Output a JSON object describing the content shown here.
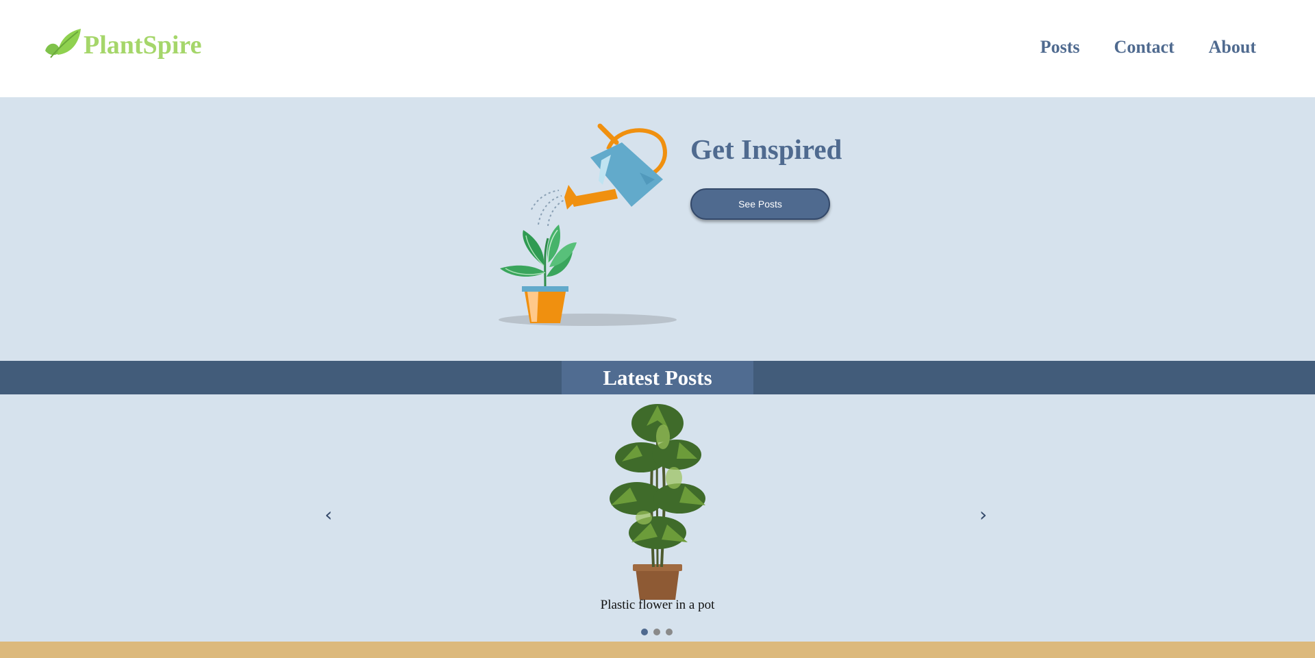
{
  "header": {
    "brand": "PlantSpire",
    "logo_icon": "leaf-icon",
    "brand_color": "#a5d66a",
    "nav": [
      {
        "label": "Posts"
      },
      {
        "label": "Contact"
      },
      {
        "label": "About"
      }
    ],
    "nav_color": "#4f6a8f"
  },
  "hero": {
    "illustration": "watering-can-plant",
    "title": "Get Inspired",
    "button_label": "See Posts",
    "background": "#d6e2ed"
  },
  "latest": {
    "title": "Latest Posts",
    "band_color": "#425c7a",
    "title_bg": "#506c91"
  },
  "carousel": {
    "prev_icon": "chevron-left-icon",
    "next_icon": "chevron-right-icon",
    "prev_glyph": "‹",
    "next_glyph": "›",
    "slides": [
      {
        "image": "potted-plant-photo",
        "caption": "Plastic flower in a pot"
      }
    ],
    "dot_count": 3,
    "active_dot": 1
  },
  "footer": {
    "color": "#dcb97c"
  }
}
